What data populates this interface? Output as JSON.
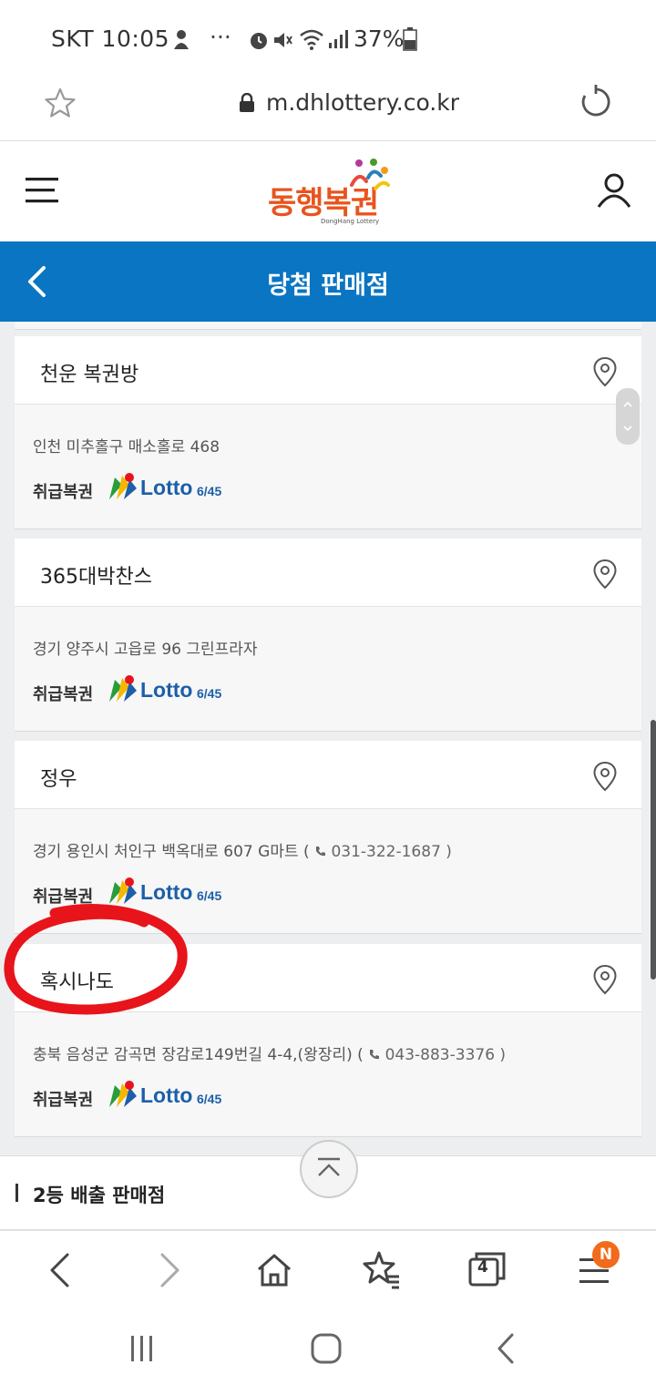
{
  "status_bar": {
    "carrier_time": "SKT 10:05",
    "dots": "···",
    "battery": "37%"
  },
  "url_bar": {
    "url": "m.dhlottery.co.kr"
  },
  "site_header": {
    "logo_text": "동행복권",
    "logo_sub": "DongHang Lottery"
  },
  "title_bar": {
    "title": "당첨 판매점"
  },
  "stores": [
    {
      "name": "천운 복권방",
      "address": "인천 미추홀구 매소홀로 468",
      "phone": "",
      "ticket_label": "취급복권"
    },
    {
      "name": "365대박찬스",
      "address": "경기 양주시 고읍로 96 그린프라자",
      "phone": "",
      "ticket_label": "취급복권"
    },
    {
      "name": "정우",
      "address": "경기 용인시 처인구 백옥대로 607 G마트 (",
      "phone": "031-322-1687 )",
      "ticket_label": "취급복권"
    },
    {
      "name": "혹시나도",
      "address": "충북 음성군 감곡면 장감로149번길 4-4,(왕장리) (",
      "phone": "043-883-3376 )",
      "ticket_label": "취급복권"
    }
  ],
  "lotto": {
    "word": "Lotto",
    "num": "6/45"
  },
  "second_section": {
    "label": "2등 배출 판매점"
  },
  "browser_toolbar": {
    "tab_count": "4",
    "badge": "N"
  },
  "colors": {
    "title_bar": "#0a75c2",
    "logo_orange": "#e8541e",
    "lotto_blue": "#1c5fa8",
    "annotation_red": "#e8141b",
    "badge_orange": "#f26a1b"
  }
}
